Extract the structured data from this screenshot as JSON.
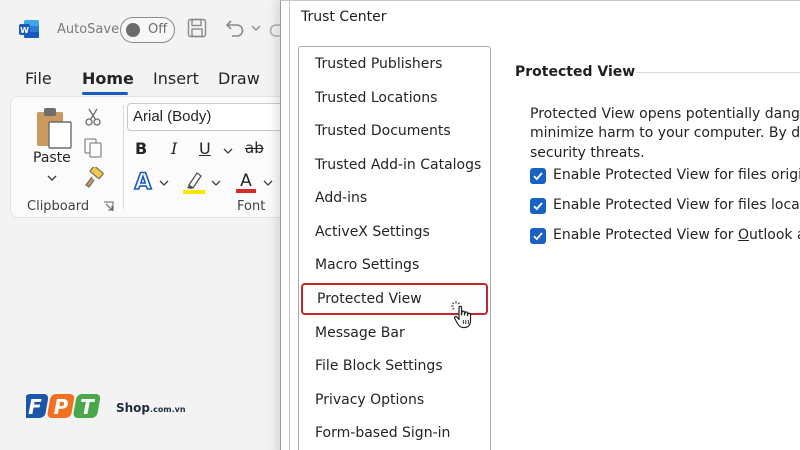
{
  "word": {
    "autosave_label": "AutoSave",
    "autosave_state": "Off",
    "tabs": [
      "File",
      "Home",
      "Insert",
      "Draw"
    ],
    "active_tab": "Home",
    "clipboard": {
      "paste_label": "Paste",
      "group_label": "Clipboard"
    },
    "font": {
      "font_name": "Arial (Body)",
      "bold": "B",
      "italic": "I",
      "underline": "U",
      "strike": "ab",
      "group_label": "Font"
    },
    "colors": {
      "brand_blue": "#185abd",
      "highlight": "#ffe600",
      "font_color": "#d92b2b"
    }
  },
  "watermark": {
    "brand_letters": [
      "F",
      "P",
      "T"
    ],
    "shop_text": "Shop",
    "shop_domain": ".com.vn"
  },
  "dialog": {
    "title": "Trust Center",
    "nav_items": [
      "Trusted Publishers",
      "Trusted Locations",
      "Trusted Documents",
      "Trusted Add-in Catalogs",
      "Add-ins",
      "ActiveX Settings",
      "Macro Settings",
      "Protected View",
      "Message Bar",
      "File Block Settings",
      "Privacy Options",
      "Form-based Sign-in"
    ],
    "selected_item": "Protected View",
    "selected_border_color": "#c4262e",
    "section": {
      "title": "Protected View",
      "description_lines": [
        "Protected View opens potentially dangerou",
        "minimize harm to your computer. By disal",
        "security threats."
      ],
      "checkboxes": [
        {
          "label": "Enable Protected View for files originat",
          "checked": true
        },
        {
          "label": "Enable Protected View for files located",
          "checked": true
        },
        {
          "label_before": "Enable Protected View for ",
          "label_underlined": "O",
          "label_after": "utlook atta",
          "checked": true
        }
      ],
      "checkbox_color": "#1762c3"
    }
  }
}
